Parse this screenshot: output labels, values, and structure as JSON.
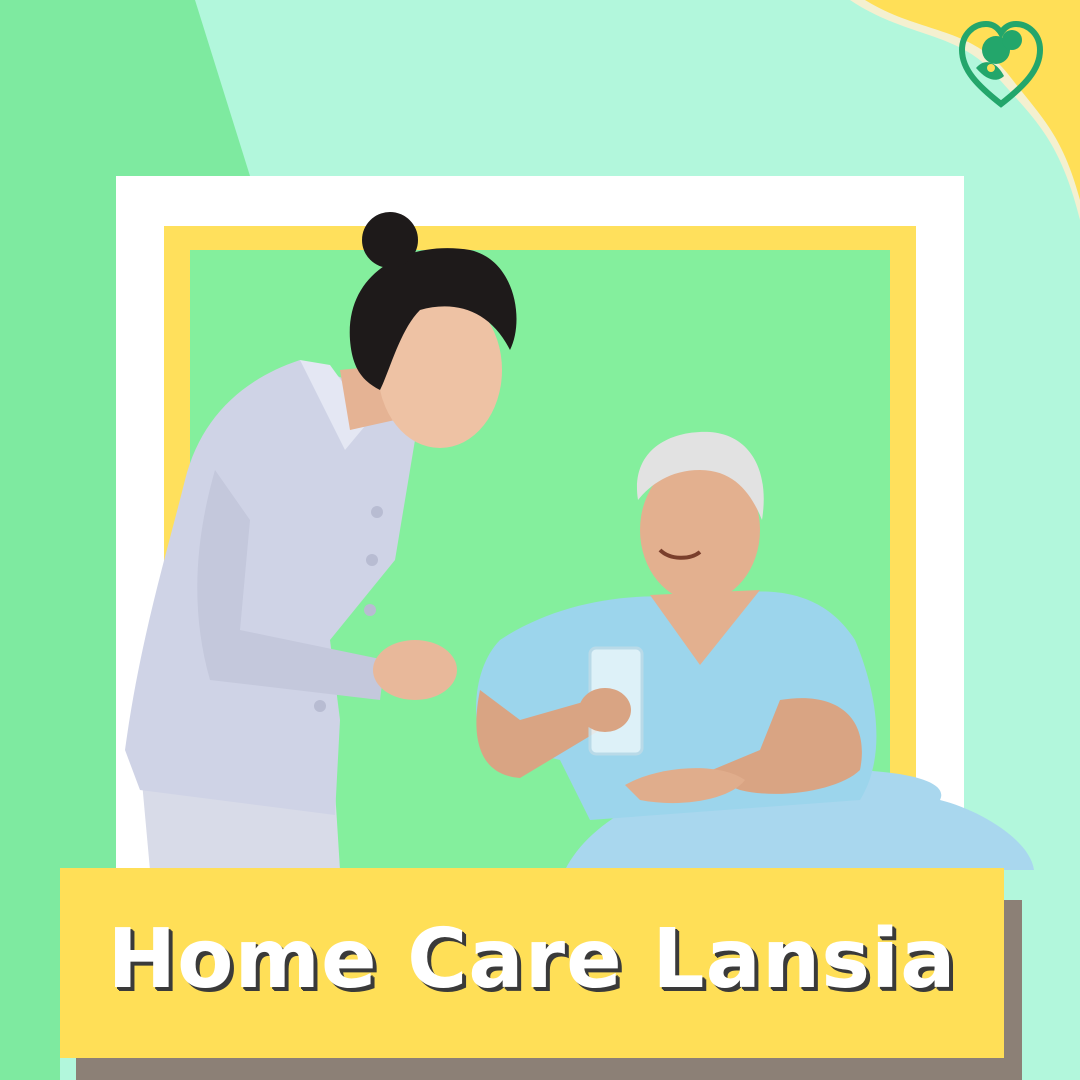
{
  "title": "Home Care Lansia",
  "logo": {
    "icon": "heart-family-icon"
  },
  "colors": {
    "background_mint": "#b2f7dc",
    "background_green": "#7eeaa0",
    "frame_white": "#ffffff",
    "frame_yellow": "#ffe05c",
    "inner_green": "#84ef9d",
    "title_band": "#ffdf57",
    "shadow_band": "#8c8076",
    "logo_green": "#23a66b"
  },
  "photo": {
    "subjects": [
      "nurse",
      "elderly-patient"
    ]
  }
}
